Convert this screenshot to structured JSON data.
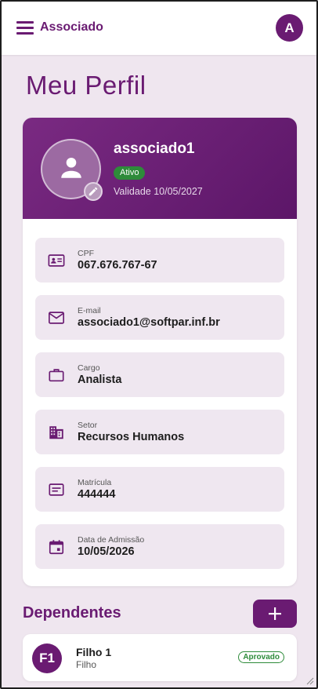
{
  "appbar": {
    "title": "Associado",
    "avatar_letter": "A",
    "menu_icon": "menu-icon"
  },
  "page": {
    "title": "Meu Perfil"
  },
  "profile": {
    "name": "associado1",
    "status": "Ativo",
    "validity": "Validade 10/05/2027",
    "photo_icon": "person-icon",
    "edit_icon": "pencil-icon"
  },
  "info": [
    {
      "label": "CPF",
      "value": "067.676.767-67",
      "icon": "id-card-icon"
    },
    {
      "label": "E-mail",
      "value": "associado1@softpar.inf.br",
      "icon": "email-icon"
    },
    {
      "label": "Cargo",
      "value": "Analista",
      "icon": "briefcase-icon"
    },
    {
      "label": "Setor",
      "value": "Recursos Humanos",
      "icon": "building-icon"
    },
    {
      "label": "Matrícula",
      "value": "444444",
      "icon": "badge-icon"
    },
    {
      "label": "Data de Admissão",
      "value": "10/05/2026",
      "icon": "calendar-icon"
    }
  ],
  "dependents": {
    "title": "Dependentes",
    "add_icon": "plus-icon",
    "items": [
      {
        "initials": "F1",
        "name": "Filho 1",
        "relation": "Filho",
        "status": "Aprovado"
      }
    ]
  },
  "colors": {
    "primary": "#6a1b72",
    "background": "#efe6ef",
    "success": "#2e8b3a"
  }
}
